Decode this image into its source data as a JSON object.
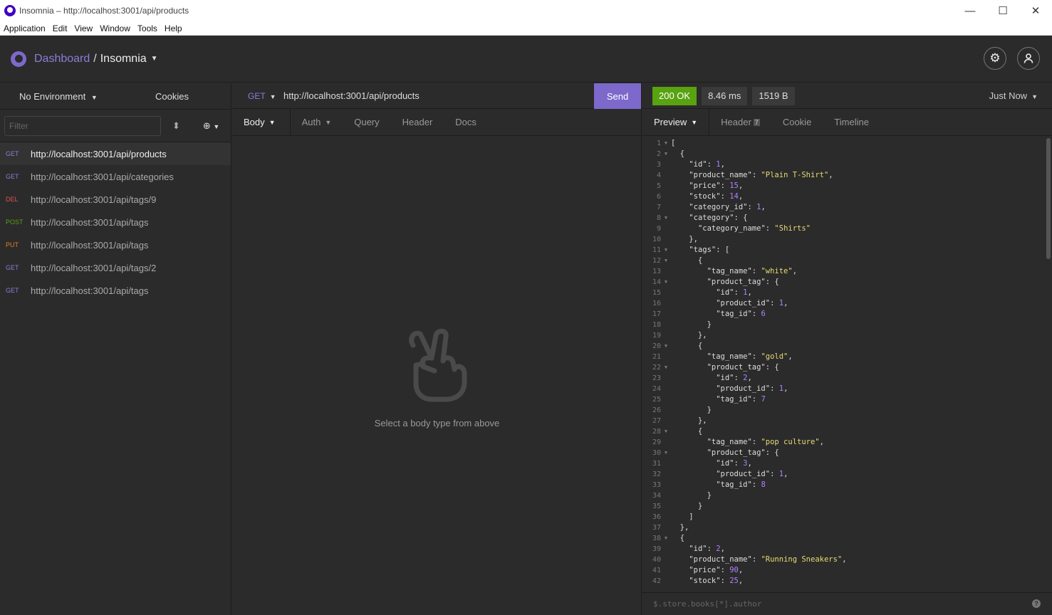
{
  "window": {
    "title": "Insomnia – http://localhost:3001/api/products",
    "minimize": "—",
    "maximize": "☐",
    "close": "✕"
  },
  "menu": [
    "Application",
    "Edit",
    "View",
    "Window",
    "Tools",
    "Help"
  ],
  "header": {
    "dashboard": "Dashboard",
    "separator": "/",
    "workspace": "Insomnia"
  },
  "sidebar": {
    "environment": "No Environment",
    "cookies": "Cookies",
    "filter_placeholder": "Filter",
    "requests": [
      {
        "method": "GET",
        "url": "http://localhost:3001/api/products",
        "active": true
      },
      {
        "method": "GET",
        "url": "http://localhost:3001/api/categories"
      },
      {
        "method": "DEL",
        "url": "http://localhost:3001/api/tags/9"
      },
      {
        "method": "POST",
        "url": "http://localhost:3001/api/tags"
      },
      {
        "method": "PUT",
        "url": "http://localhost:3001/api/tags"
      },
      {
        "method": "GET",
        "url": "http://localhost:3001/api/tags/2"
      },
      {
        "method": "GET",
        "url": "http://localhost:3001/api/tags"
      }
    ]
  },
  "request": {
    "method": "GET",
    "url": "http://localhost:3001/api/products",
    "send": "Send",
    "tabs": {
      "body": "Body",
      "auth": "Auth",
      "query": "Query",
      "header": "Header",
      "docs": "Docs"
    },
    "empty_message": "Select a body type from above"
  },
  "response": {
    "status": "200 OK",
    "time": "8.46 ms",
    "size": "1519 B",
    "when": "Just Now",
    "tabs": {
      "preview": "Preview",
      "header": "Header",
      "header_count": "7",
      "cookie": "Cookie",
      "timeline": "Timeline"
    },
    "filter_placeholder": "$.store.books[*].author",
    "help": "?",
    "lines": [
      "[",
      "  {",
      "    \"id\": 1,",
      "    \"product_name\": \"Plain T-Shirt\",",
      "    \"price\": 15,",
      "    \"stock\": 14,",
      "    \"category_id\": 1,",
      "    \"category\": {",
      "      \"category_name\": \"Shirts\"",
      "    },",
      "    \"tags\": [",
      "      {",
      "        \"tag_name\": \"white\",",
      "        \"product_tag\": {",
      "          \"id\": 1,",
      "          \"product_id\": 1,",
      "          \"tag_id\": 6",
      "        }",
      "      },",
      "      {",
      "        \"tag_name\": \"gold\",",
      "        \"product_tag\": {",
      "          \"id\": 2,",
      "          \"product_id\": 1,",
      "          \"tag_id\": 7",
      "        }",
      "      },",
      "      {",
      "        \"tag_name\": \"pop culture\",",
      "        \"product_tag\": {",
      "          \"id\": 3,",
      "          \"product_id\": 1,",
      "          \"tag_id\": 8",
      "        }",
      "      }",
      "    ]",
      "  },",
      "  {",
      "    \"id\": 2,",
      "    \"product_name\": \"Running Sneakers\",",
      "    \"price\": 90,",
      "    \"stock\": 25,"
    ],
    "fold_lines": [
      1,
      2,
      8,
      11,
      12,
      14,
      20,
      22,
      28,
      30,
      38
    ]
  },
  "colors": {
    "accent": "#7d69cb",
    "ok": "#59a210",
    "background": "#2b2b2b"
  }
}
